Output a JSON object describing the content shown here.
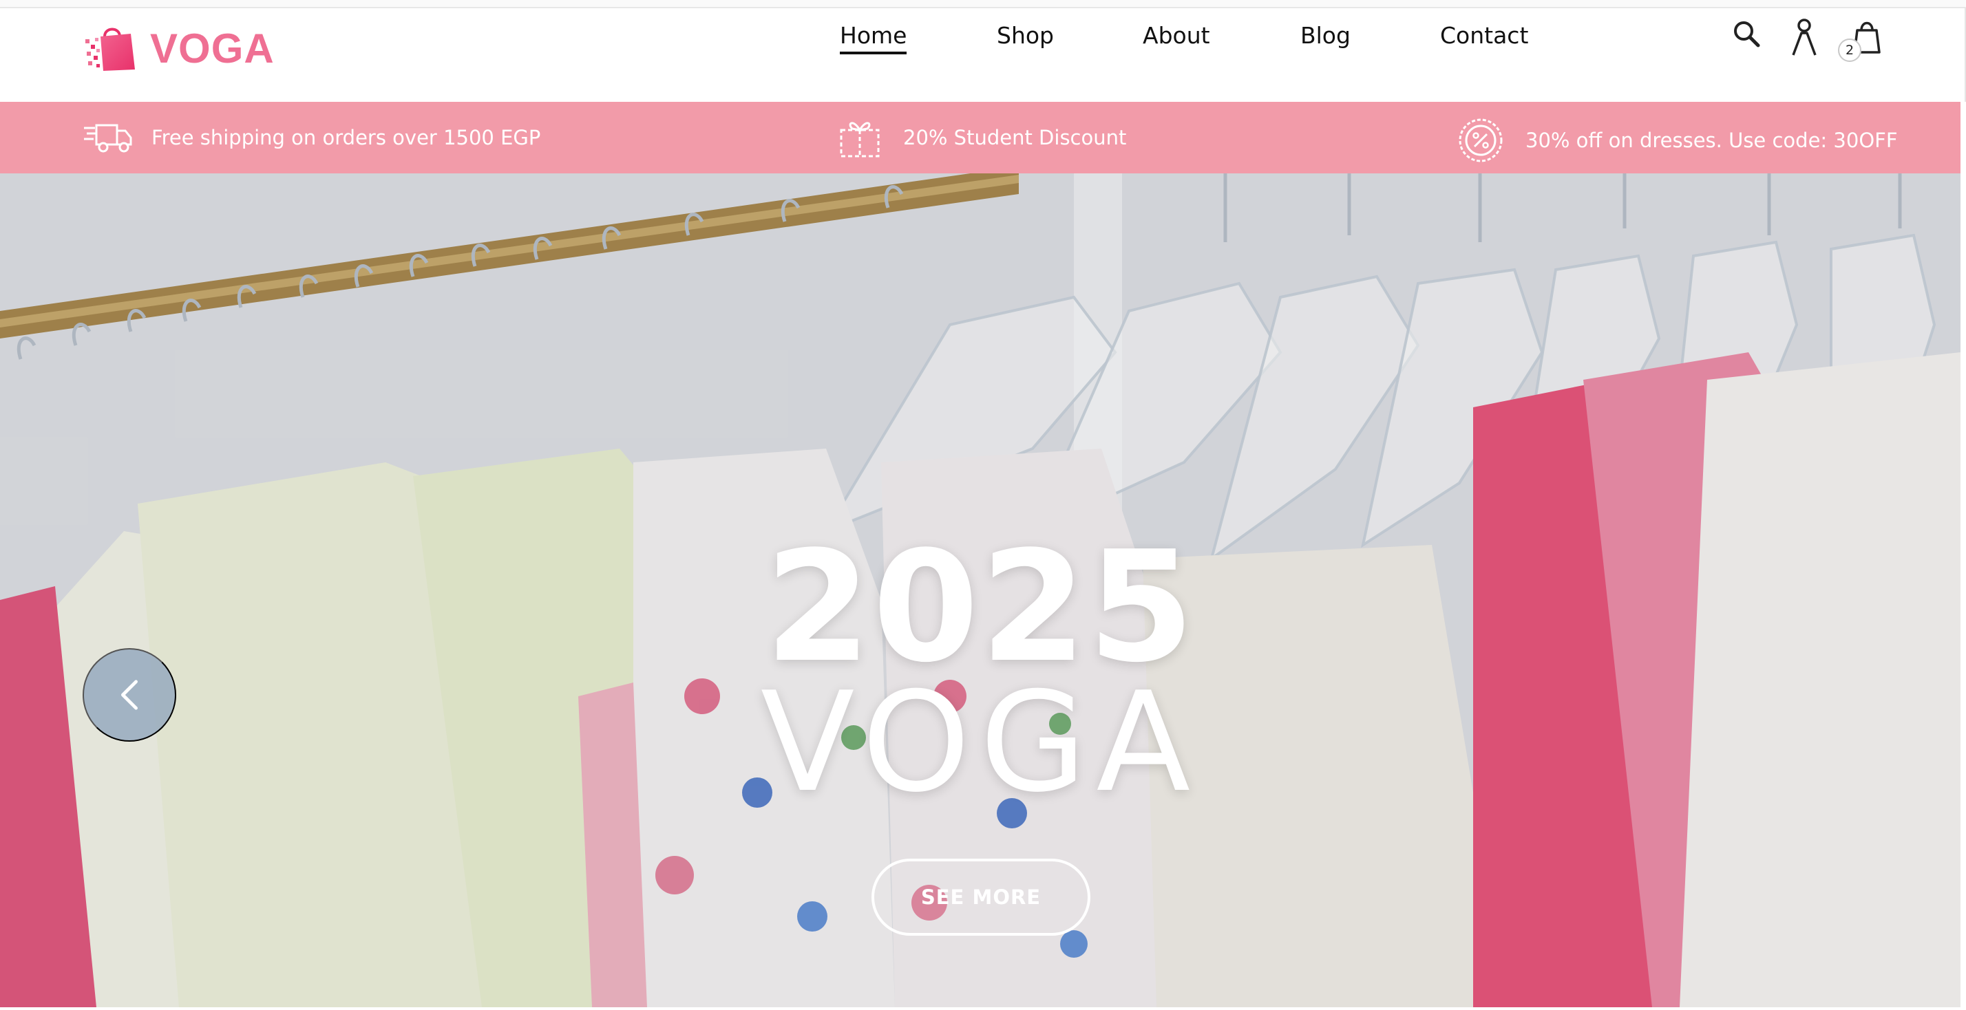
{
  "brand": {
    "name": "VOGA",
    "accent_color": "#ef6f93"
  },
  "nav": {
    "items": [
      {
        "label": "Home",
        "active": true
      },
      {
        "label": "Shop",
        "active": false
      },
      {
        "label": "About",
        "active": false
      },
      {
        "label": "Blog",
        "active": false
      },
      {
        "label": "Contact",
        "active": false
      }
    ]
  },
  "header_icons": {
    "search": "search-icon",
    "account": "user-icon",
    "cart": "shopping-bag-icon",
    "cart_count": "2"
  },
  "promo_bar": {
    "background_color": "#f29ba9",
    "items": [
      {
        "icon": "delivery-truck-icon",
        "text": "Free shipping on orders over 1500 EGP"
      },
      {
        "icon": "gift-box-icon",
        "text": "20% Student Discount"
      },
      {
        "icon": "percent-badge-icon",
        "text": "30% off on dresses. Use code: 30OFF"
      }
    ]
  },
  "hero": {
    "title_year": "2025",
    "title_brand": "VOGA",
    "cta_label": "SEE MORE",
    "prev_icon": "chevron-left-icon"
  }
}
